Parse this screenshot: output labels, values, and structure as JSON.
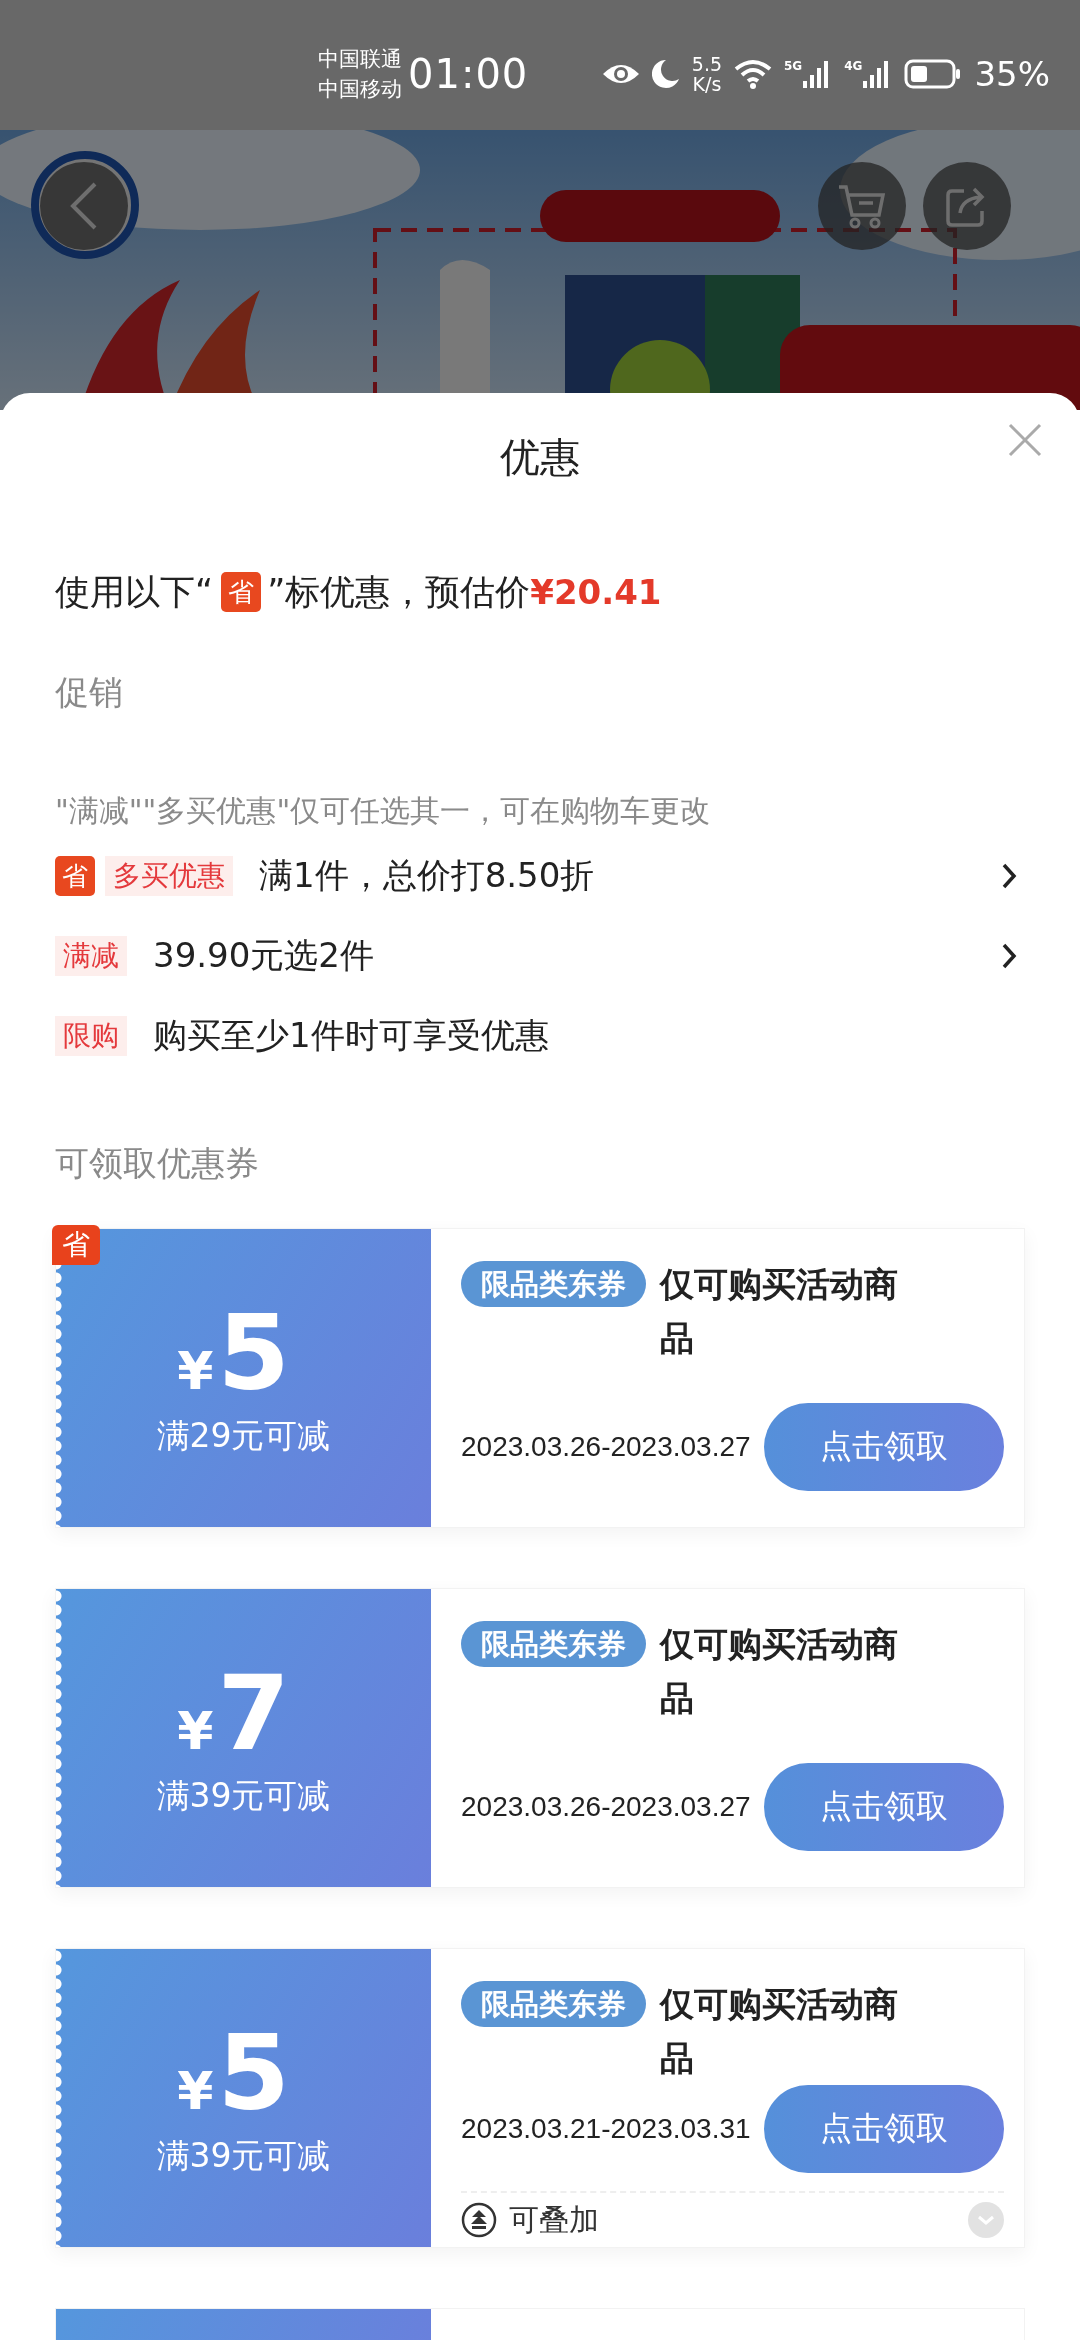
{
  "status_bar": {
    "carrier_1": "中国联通",
    "carrier_2": "中国移动",
    "time": "01:00",
    "speed_value": "5.5",
    "speed_unit": "K/s",
    "net_1": "5G",
    "net_2": "4G",
    "battery": "35%"
  },
  "sheet": {
    "title": "优惠",
    "intro": {
      "before": "使用以下“",
      "badge": "省",
      "after": "”标优惠，预估价",
      "price": "¥20.41"
    },
    "promo_heading": "促销",
    "promo_note": "\"满减\"\"多买优惠\"仅可任选其一，可在购物车更改",
    "promotions": [
      {
        "badge": "省",
        "tag": "多买优惠",
        "text": "满1件，总价打8.50折",
        "expandable": true
      },
      {
        "tag": "满减",
        "text": "39.90元选2件",
        "expandable": true
      },
      {
        "tag": "限购",
        "text": "购买至少1件时可享受优惠",
        "expandable": false
      }
    ],
    "coupon_heading": "可领取优惠券",
    "coupons": [
      {
        "badge": "省",
        "currency": "¥",
        "amount": "5",
        "condition": "满29元可减",
        "tag": "限品类东券",
        "title": "仅可购买活动商品",
        "dates": "2023.03.26-2023.03.27",
        "button": "点击领取"
      },
      {
        "currency": "¥",
        "amount": "7",
        "condition": "满39元可减",
        "tag": "限品类东券",
        "title": "仅可购买活动商品",
        "dates": "2023.03.26-2023.03.27",
        "button": "点击领取"
      },
      {
        "currency": "¥",
        "amount": "5",
        "condition": "满39元可减",
        "tag": "限品类东券",
        "title": "仅可购买活动商品",
        "dates": "2023.03.21-2023.03.31",
        "button": "点击领取",
        "stack_label": "可叠加"
      }
    ]
  }
}
